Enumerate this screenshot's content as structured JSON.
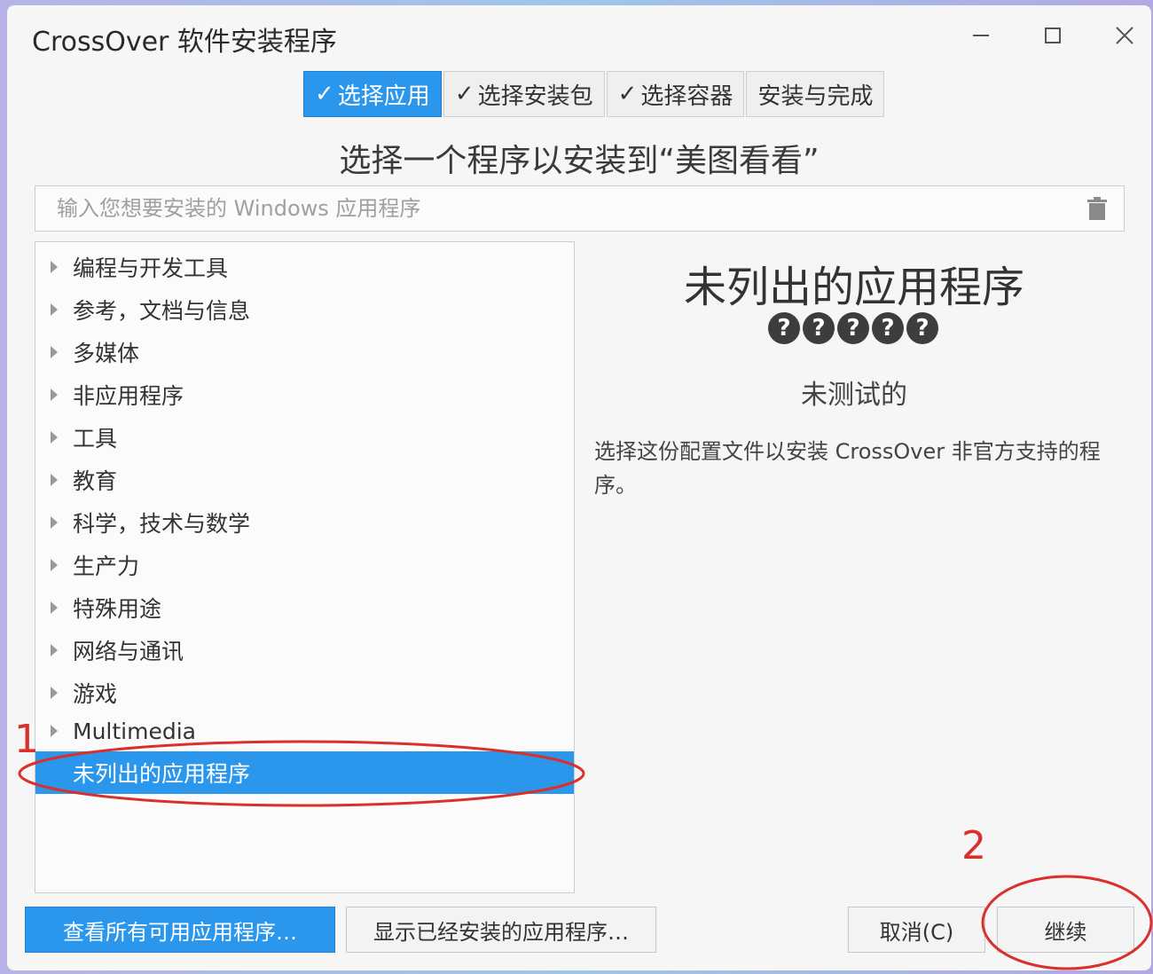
{
  "window": {
    "title": "CrossOver 软件安装程序"
  },
  "steps": [
    {
      "label": "选择应用",
      "checked": true,
      "active": true
    },
    {
      "label": "选择安装包",
      "checked": true,
      "active": false
    },
    {
      "label": "选择容器",
      "checked": true,
      "active": false
    },
    {
      "label": "安装与完成",
      "checked": false,
      "active": false
    }
  ],
  "check_glyph": "✓",
  "heading": "选择一个程序以安装到“美图看看”",
  "search": {
    "placeholder": "输入您想要安装的 Windows 应用程序",
    "value": ""
  },
  "categories": [
    {
      "label": "编程与开发工具"
    },
    {
      "label": "参考，文档与信息"
    },
    {
      "label": "多媒体"
    },
    {
      "label": "非应用程序"
    },
    {
      "label": "工具"
    },
    {
      "label": "教育"
    },
    {
      "label": "科学，技术与数学"
    },
    {
      "label": "生产力"
    },
    {
      "label": "特殊用途"
    },
    {
      "label": "网络与通讯"
    },
    {
      "label": "游戏"
    },
    {
      "label": "Multimedia"
    },
    {
      "label": "未列出的应用程序",
      "selected": true
    }
  ],
  "detail": {
    "title": "未列出的应用程序",
    "rating_glyph": "?",
    "rating_count": 5,
    "status": "未测试的",
    "description": "选择这份配置文件以安装 CrossOver 非官方支持的程序。"
  },
  "buttons": {
    "view_all": "查看所有可用应用程序…",
    "show_installed": "显示已经安装的应用程序…",
    "cancel": "取消(C)",
    "continue": "继续"
  },
  "annotations": {
    "marker_1": "1",
    "marker_2": "2",
    "color": "#d9302c"
  },
  "colors": {
    "accent": "#2b97ec"
  }
}
